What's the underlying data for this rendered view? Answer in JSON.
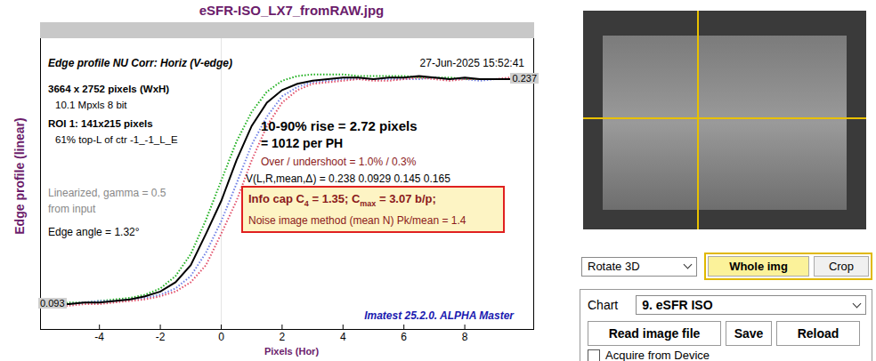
{
  "window": {
    "title": "eSFR-ISO_LX7_fromRAW.jpg"
  },
  "plot": {
    "header": "Edge profile  NU Corr: Horiz (V-edge)",
    "timestamp": "27-Jun-2025 15:52:41",
    "info": [
      {
        "text": "3664 x 2752 pixels (WxH)",
        "kind": "bold"
      },
      {
        "text": "10.1 Mpxls   8 bit",
        "kind": "indent"
      },
      {
        "text": "ROI 1:  141x215 pixels",
        "kind": "bold"
      },
      {
        "text": "61% top-L of ctr  -1_-1_L_E",
        "kind": "indent"
      }
    ],
    "linearized": [
      "Linearized, gamma = 0.5",
      "from input"
    ],
    "edge_angle": "Edge angle = 1.32°",
    "rise": "10-90% rise = 2.72 pixels",
    "per_ph": "=   1012 per PH",
    "overshoot": "Over / undershoot =  1.0% /  0.3%",
    "v_line": "V(L,R,mean,Δ) = 0.238  0.0929  0.145  0.165",
    "info_cap": [
      {
        "text": "Info cap C",
        "sub": false
      },
      {
        "text": "4",
        "sub": true
      },
      {
        "text": " = 1.35;  C",
        "sub": false
      },
      {
        "text": "max",
        "sub": true
      },
      {
        "text": " = 3.07 b/p;",
        "sub": false
      }
    ],
    "noise_method": "Noise image method (mean N)   Pk/mean = 1.4",
    "version": "Imatest 25.2.0. ALPHA Master",
    "value_high": "0.237",
    "value_low": "0.093",
    "y_label": "Edge profile (linear)",
    "x_label": "Pixels (Hor)",
    "x_ticks": [
      "-4",
      "-2",
      "0",
      "2",
      "4",
      "6",
      "8"
    ],
    "x": [
      -5.5,
      -5,
      -4.5,
      -4,
      -3.5,
      -3,
      -2.5,
      -2,
      -1.5,
      -1,
      -0.5,
      0,
      0.5,
      1,
      1.5,
      2,
      2.5,
      3,
      3.5,
      4,
      4.5,
      5,
      5.5,
      6,
      6.5,
      7,
      7.5,
      8,
      8.5,
      9,
      9.5
    ],
    "series": [
      {
        "name": "green",
        "color": "#1fb01f",
        "kind": "dotted",
        "values": [
          0.093,
          0.094,
          0.094,
          0.095,
          0.096,
          0.097,
          0.099,
          0.103,
          0.111,
          0.125,
          0.147,
          0.172,
          0.197,
          0.216,
          0.229,
          0.236,
          0.239,
          0.24,
          0.24,
          0.24,
          0.239,
          0.239,
          0.239,
          0.239,
          0.238,
          0.238,
          0.238,
          0.237,
          0.237,
          0.237,
          0.237
        ]
      },
      {
        "name": "blue",
        "color": "#6f7fe6",
        "kind": "dotted",
        "values": [
          0.092,
          0.093,
          0.094,
          0.095,
          0.095,
          0.096,
          0.097,
          0.099,
          0.103,
          0.111,
          0.126,
          0.146,
          0.17,
          0.195,
          0.213,
          0.226,
          0.232,
          0.235,
          0.236,
          0.237,
          0.237,
          0.237,
          0.237,
          0.237,
          0.237,
          0.238,
          0.237,
          0.237,
          0.236,
          0.237,
          0.237
        ]
      },
      {
        "name": "red",
        "color": "#e2506a",
        "kind": "dotted",
        "values": [
          0.091,
          0.092,
          0.093,
          0.093,
          0.094,
          0.095,
          0.096,
          0.098,
          0.101,
          0.107,
          0.118,
          0.138,
          0.159,
          0.185,
          0.207,
          0.222,
          0.23,
          0.234,
          0.235,
          0.236,
          0.237,
          0.236,
          0.236,
          0.237,
          0.238,
          0.237,
          0.236,
          0.237,
          0.237,
          0.237,
          0.238
        ]
      },
      {
        "name": "black",
        "color": "#000000",
        "kind": "solid",
        "values": [
          0.093,
          0.093,
          0.094,
          0.094,
          0.095,
          0.096,
          0.098,
          0.101,
          0.107,
          0.118,
          0.138,
          0.159,
          0.185,
          0.207,
          0.222,
          0.23,
          0.234,
          0.236,
          0.237,
          0.238,
          0.238,
          0.237,
          0.238,
          0.238,
          0.239,
          0.238,
          0.237,
          0.238,
          0.237,
          0.237,
          0.237
        ]
      }
    ]
  },
  "controls": {
    "rotate": "Rotate 3D",
    "view": [
      {
        "label": "Whole img",
        "selected": true
      },
      {
        "label": "Crop",
        "selected": false
      }
    ],
    "chart_label": "Chart",
    "chart_value": "9. eSFR ISO",
    "buttons": [
      "Read image file",
      "Save",
      "Reload"
    ],
    "acquire": {
      "label": "Acquire from Device",
      "checked": false
    }
  }
}
